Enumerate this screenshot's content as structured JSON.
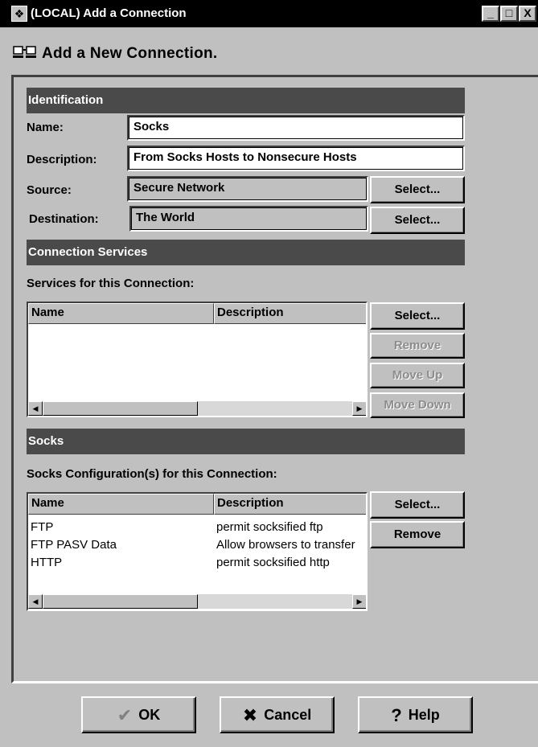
{
  "window": {
    "title": "(LOCAL) Add a Connection",
    "controls": {
      "minimize": "_",
      "maximize": "□",
      "close": "X"
    }
  },
  "header": {
    "title": "Add a New Connection."
  },
  "identification": {
    "section_title": "Identification",
    "name_label": "Name:",
    "name_value": "Socks",
    "description_label": "Description:",
    "description_value": "From Socks Hosts to Nonsecure Hosts",
    "source_label": "Source:",
    "source_value": "Secure Network",
    "source_select": "Select...",
    "destination_label": "Destination:",
    "destination_value": "The World",
    "destination_select": "Select..."
  },
  "services": {
    "section_title": "Connection Services",
    "list_label": "Services for this Connection:",
    "columns": [
      "Name",
      "Description"
    ],
    "rows": [],
    "buttons": {
      "select": "Select...",
      "remove": "Remove",
      "move_up": "Move Up",
      "move_down": "Move Down"
    }
  },
  "socks": {
    "section_title": "Socks",
    "list_label": "Socks Configuration(s) for this Connection:",
    "columns": [
      "Name",
      "Description"
    ],
    "rows": [
      [
        "FTP",
        "permit socksified ftp"
      ],
      [
        "FTP PASV Data",
        "Allow browsers to transfer"
      ],
      [
        "HTTP",
        "permit socksified http"
      ]
    ],
    "buttons": {
      "select": "Select...",
      "remove": "Remove"
    }
  },
  "footer": {
    "ok": "OK",
    "cancel": "Cancel",
    "help": "Help"
  },
  "icons": {
    "app": "app-icon",
    "header": "connection-icon",
    "ok": "checkmark-icon",
    "cancel": "x-icon",
    "help": "question-icon"
  },
  "colors": {
    "window_bg": "#c0c0c0",
    "titlebar_bg": "#000000",
    "section_bar_bg": "#4a4a4a",
    "disabled_text": "#8c8c8c"
  }
}
